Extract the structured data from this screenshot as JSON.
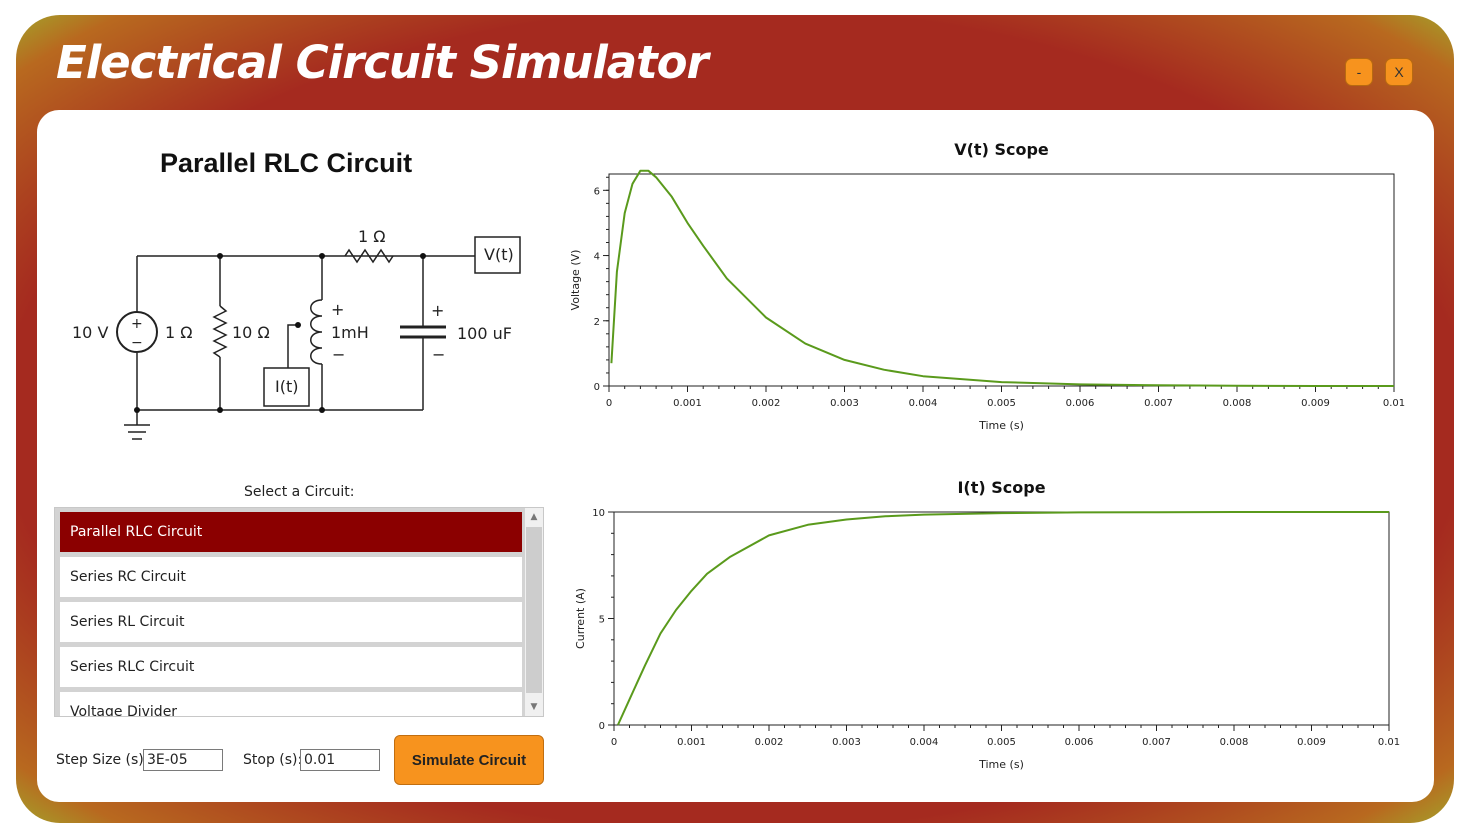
{
  "window": {
    "title": "Electrical Circuit Simulator",
    "minimize_label": "-",
    "close_label": "X"
  },
  "circuit": {
    "title": "Parallel RLC Circuit",
    "labels": {
      "source": "10 V",
      "source_plus": "+",
      "source_minus": "−",
      "r_source": "1 Ω",
      "r_parallel": "10 Ω",
      "r_series": "1 Ω",
      "inductor": "1mH",
      "inductor_plus": "+",
      "inductor_minus": "−",
      "capacitor": "100 uF",
      "capacitor_plus": "+",
      "capacitor_minus": "−",
      "probe_v": "V(t)",
      "probe_i": "I(t)"
    }
  },
  "selector": {
    "label": "Select a Circuit:",
    "items": [
      "Parallel RLC Circuit",
      "Series RC Circuit",
      "Series RL Circuit",
      "Series RLC Circuit",
      "Voltage Divider"
    ],
    "selected_index": 0
  },
  "controls": {
    "step_label": "Step Size (s):",
    "step_value": "3E-05",
    "stop_label": "Stop (s):",
    "stop_value": "0.01",
    "simulate_label": "Simulate Circuit"
  },
  "colors": {
    "accent": "#a52a1f",
    "button": "#f7931e",
    "selected_item": "#8b0000",
    "trace": "#5a9a1c"
  },
  "chart_data": [
    {
      "type": "line",
      "title": "V(t) Scope",
      "xlabel": "Time (s)",
      "ylabel": "Voltage (V)",
      "xlim": [
        0,
        0.01
      ],
      "ylim": [
        0,
        6.5
      ],
      "xticks": [
        "0",
        "0.001",
        "0.002",
        "0.003",
        "0.004",
        "0.005",
        "0.006",
        "0.007",
        "0.008",
        "0.009",
        "0.01"
      ],
      "yticks": [
        "0",
        "2",
        "4",
        "6"
      ],
      "ytick_values": [
        0,
        2,
        4,
        6
      ],
      "grid": false,
      "series": [
        {
          "x": [
            3e-05,
            0.0001,
            0.0002,
            0.0003,
            0.0004,
            0.0005,
            0.0006,
            0.0008,
            0.001,
            0.0012,
            0.0015,
            0.002,
            0.0025,
            0.003,
            0.0035,
            0.004,
            0.005,
            0.006,
            0.007,
            0.008,
            0.009,
            0.01
          ],
          "y": [
            0.7,
            3.5,
            5.3,
            6.2,
            6.6,
            6.6,
            6.4,
            5.8,
            5.0,
            4.3,
            3.3,
            2.1,
            1.3,
            0.8,
            0.5,
            0.3,
            0.12,
            0.05,
            0.02,
            0.01,
            0.0,
            0.0
          ]
        }
      ]
    },
    {
      "type": "line",
      "title": "I(t) Scope",
      "xlabel": "Time (s)",
      "ylabel": "Current (A)",
      "xlim": [
        0,
        0.01
      ],
      "ylim": [
        0,
        10
      ],
      "xticks": [
        "0",
        "0.001",
        "0.002",
        "0.003",
        "0.004",
        "0.005",
        "0.006",
        "0.007",
        "0.008",
        "0.009",
        "0.01"
      ],
      "yticks": [
        "0",
        "5",
        "10"
      ],
      "ytick_values": [
        0,
        5,
        10
      ],
      "grid": false,
      "series": [
        {
          "x": [
            5e-05,
            0.0002,
            0.0004,
            0.0006,
            0.0008,
            0.001,
            0.0012,
            0.0015,
            0.002,
            0.0025,
            0.003,
            0.0035,
            0.004,
            0.005,
            0.006,
            0.007,
            0.008,
            0.009,
            0.01
          ],
          "y": [
            0.0,
            1.2,
            2.8,
            4.3,
            5.4,
            6.3,
            7.1,
            7.9,
            8.9,
            9.4,
            9.65,
            9.8,
            9.88,
            9.95,
            9.98,
            9.99,
            10.0,
            10.0,
            10.0
          ]
        }
      ]
    }
  ]
}
